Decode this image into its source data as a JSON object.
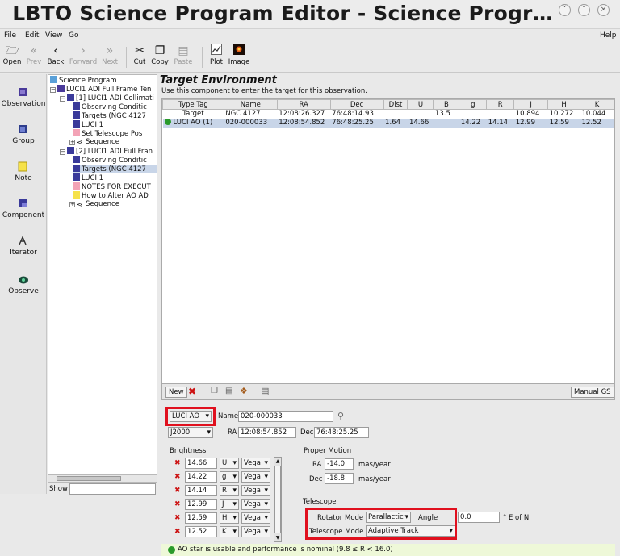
{
  "window": {
    "title": "LBTO Science Program Editor - Science Progr…",
    "controls": [
      "˅",
      "˄",
      "×"
    ]
  },
  "menubar": {
    "file": "File",
    "edit": "Edit",
    "view": "View",
    "go": "Go",
    "help": "Help"
  },
  "toolbar": {
    "open": "Open",
    "prev": "Prev",
    "back": "Back",
    "forward": "Forward",
    "next": "Next",
    "cut": "Cut",
    "copy": "Copy",
    "paste": "Paste",
    "plot": "Plot",
    "image": "Image"
  },
  "palette": {
    "observation": "Observation",
    "group": "Group",
    "note": "Note",
    "component": "Component",
    "iterator": "Iterator",
    "observe": "Observe"
  },
  "tree": {
    "items": [
      "Science Program",
      "LUCI1 ADI  Full Frame Ten",
      "[1] LUCI1 ADI Collimati",
      "Observing Conditic",
      "Targets (NGC 4127",
      "LUCI 1",
      "Set Telescope Pos",
      "Sequence",
      "[2] LUCI1 ADI Full Fran",
      "Observing Conditic",
      "Targets (NGC 4127",
      "LUCI 1",
      "NOTES FOR EXECUT",
      "How to Alter AO AD",
      "Sequence"
    ],
    "show_label": "Show"
  },
  "editor": {
    "title": "Target Environment",
    "description": "Use this component to enter the target for this observation.",
    "columns": [
      "Type Tag",
      "Name",
      "RA",
      "Dec",
      "Dist",
      "U",
      "B",
      "g",
      "R",
      "J",
      "H",
      "K"
    ],
    "rows": [
      [
        "Target",
        "NGC 4127",
        "12:08:26.327",
        "76:48:14.93",
        "",
        "",
        "13.5",
        "",
        "",
        "10.894",
        "10.272",
        "10.044"
      ],
      [
        "LUCI AO (1)",
        "020-000033",
        "12:08:54.852",
        "76:48:25.25",
        "1.64",
        "14.66",
        "",
        "14.22",
        "14.14",
        "12.99",
        "12.59",
        "12.52"
      ]
    ],
    "buttons": {
      "new": "New",
      "manual_gs": "Manual GS"
    }
  },
  "detail": {
    "type_tag": "LUCI AO",
    "name_label": "Name",
    "name_value": "020-000033",
    "coord_system": "J2000",
    "ra_label": "RA",
    "ra_value": "12:08:54.852",
    "dec_label": "Dec",
    "dec_value": "76:48:25.25",
    "brightness_label": "Brightness",
    "brightness": [
      {
        "value": "14.66",
        "band": "U",
        "system": "Vega"
      },
      {
        "value": "14.22",
        "band": "g",
        "system": "Vega"
      },
      {
        "value": "14.14",
        "band": "R",
        "system": "Vega"
      },
      {
        "value": "12.99",
        "band": "J",
        "system": "Vega"
      },
      {
        "value": "12.59",
        "band": "H",
        "system": "Vega"
      },
      {
        "value": "12.52",
        "band": "K",
        "system": "Vega"
      }
    ],
    "proper_motion_label": "Proper Motion",
    "pm_ra_label": "RA",
    "pm_ra_value": "-14.0",
    "pm_dec_label": "Dec",
    "pm_dec_value": "-18.8",
    "pm_unit": "mas/year",
    "telescope_label": "Telescope",
    "rotator_mode_label": "Rotator Mode",
    "rotator_mode": "Parallactic",
    "angle_label": "Angle",
    "angle_value": "0.0",
    "angle_unit": "° E of N",
    "telescope_mode_label": "Telescope Mode",
    "telescope_mode": "Adaptive Track"
  },
  "status": {
    "message": "AO star is usable and performance is nominal (9.8 ≤ R < 16.0)"
  },
  "colors": {
    "highlight_red": "#e0101e",
    "status_green": "#2a9a2a",
    "selection": "#c8d5e8"
  }
}
